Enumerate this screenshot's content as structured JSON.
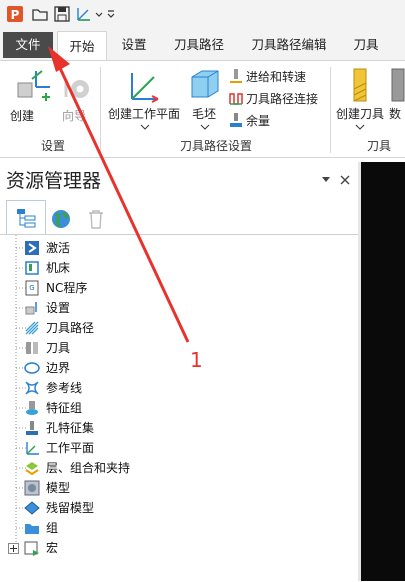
{
  "quick_access": {
    "app_icon": "app-logo-icon",
    "icons": [
      "open-folder-icon",
      "save-icon",
      "axis-icon",
      "chevron-down-icon",
      "customize-icon"
    ]
  },
  "tabs": [
    {
      "label": "文件"
    },
    {
      "label": "开始"
    },
    {
      "label": "设置"
    },
    {
      "label": "刀具路径"
    },
    {
      "label": "刀具路径编辑"
    },
    {
      "label": "刀具"
    }
  ],
  "ribbon": {
    "setup_group": {
      "label": "设置",
      "create_label": "创建",
      "wizard_label": "向导"
    },
    "toolpath_setup_group": {
      "label": "刀具路径设置",
      "create_workplane_label": "创建工作平面",
      "block_label": "毛坯",
      "feeds_speeds_label": "进给和转速",
      "toolpath_connections_label": "刀具路径连接",
      "thickness_label": "余量"
    },
    "tool_group": {
      "label": "刀具",
      "create_tool_label": "创建刀具",
      "database_label": "数"
    }
  },
  "explorer": {
    "title": "资源管理器",
    "tree": [
      {
        "label": "激活"
      },
      {
        "label": "机床"
      },
      {
        "label": "NC程序"
      },
      {
        "label": "设置"
      },
      {
        "label": "刀具路径"
      },
      {
        "label": "刀具"
      },
      {
        "label": "边界"
      },
      {
        "label": "参考线"
      },
      {
        "label": "特征组"
      },
      {
        "label": "孔特征集"
      },
      {
        "label": "工作平面"
      },
      {
        "label": "层、组合和夹持"
      },
      {
        "label": "模型"
      },
      {
        "label": "残留模型"
      },
      {
        "label": "组"
      },
      {
        "label": "宏"
      }
    ]
  },
  "annotation": {
    "number": "1",
    "color": "#e8322c"
  }
}
